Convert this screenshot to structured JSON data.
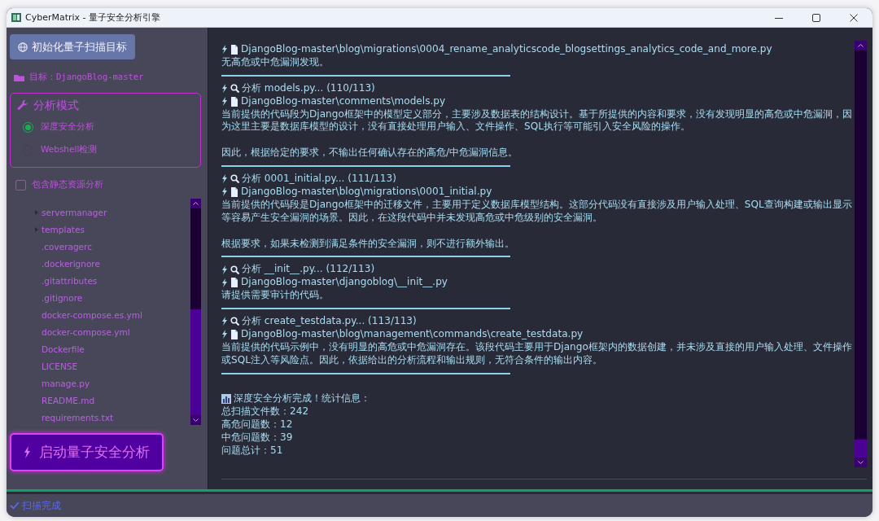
{
  "window": {
    "title": "CyberMatrix - 量子安全分析引擎"
  },
  "sidebar": {
    "init_button": "初始化量子扫描目标",
    "target": "目标：DjangoBlog-master",
    "mode_group": {
      "title": "分析模式",
      "options": [
        {
          "label": "深度安全分析",
          "selected": true
        },
        {
          "label": "Webshell检测",
          "selected": false
        }
      ]
    },
    "static_option": {
      "label": "包含静态资源分析",
      "checked": false
    },
    "file_tree": [
      {
        "name": "servermanager",
        "kind": "folder",
        "expanded": false
      },
      {
        "name": "templates",
        "kind": "folder",
        "expanded": false
      },
      {
        "name": ".coveragerc",
        "kind": "file"
      },
      {
        "name": ".dockerignore",
        "kind": "file"
      },
      {
        "name": ".gitattributes",
        "kind": "file"
      },
      {
        "name": ".gitignore",
        "kind": "file"
      },
      {
        "name": "docker-compose.es.yml",
        "kind": "file"
      },
      {
        "name": "docker-compose.yml",
        "kind": "file"
      },
      {
        "name": "Dockerfile",
        "kind": "file"
      },
      {
        "name": "LICENSE",
        "kind": "file"
      },
      {
        "name": "manage.py",
        "kind": "file"
      },
      {
        "name": "README.md",
        "kind": "file"
      },
      {
        "name": "requirements.txt",
        "kind": "file"
      }
    ],
    "start_button": "启动量子安全分析"
  },
  "log": {
    "lines": [
      {
        "kind": "file",
        "text": "DjangoBlog-master\\blog\\migrations\\0004_rename_analyticscode_blogsettings_analytics_code_and_more.py"
      },
      {
        "kind": "text",
        "text": "无高危或中危漏洞发现。"
      },
      {
        "kind": "divider"
      },
      {
        "kind": "analyze",
        "text": "分析 models.py... (110/113)"
      },
      {
        "kind": "file",
        "text": "DjangoBlog-master\\comments\\models.py"
      },
      {
        "kind": "text",
        "text": "当前提供的代码段为Django框架中的模型定义部分，主要涉及数据表的结构设计。基于所提供的内容和要求，没有发现明显的高危或中危漏洞，因为这里主要是数据库模型的设计，没有直接处理用户输入、文件操作、SQL执行等可能引入安全风险的操作。"
      },
      {
        "kind": "blank"
      },
      {
        "kind": "text",
        "text": "因此，根据给定的要求，不输出任何确认存在的高危/中危漏洞信息。"
      },
      {
        "kind": "divider"
      },
      {
        "kind": "analyze",
        "text": "分析 0001_initial.py... (111/113)"
      },
      {
        "kind": "file",
        "text": "DjangoBlog-master\\blog\\migrations\\0001_initial.py"
      },
      {
        "kind": "text",
        "text": "当前提供的代码段是Django框架中的迁移文件，主要用于定义数据库模型结构。这部分代码没有直接涉及用户输入处理、SQL查询构建或输出显示等容易产生安全漏洞的场景。因此，在这段代码中并未发现高危或中危级别的安全漏洞。"
      },
      {
        "kind": "blank"
      },
      {
        "kind": "text",
        "text": "根据要求，如果未检测到满足条件的安全漏洞，则不进行额外输出。"
      },
      {
        "kind": "divider"
      },
      {
        "kind": "analyze",
        "text": "分析 __init__.py... (112/113)"
      },
      {
        "kind": "file",
        "text": "DjangoBlog-master\\djangoblog\\__init__.py"
      },
      {
        "kind": "text",
        "text": "请提供需要审计的代码。"
      },
      {
        "kind": "divider"
      },
      {
        "kind": "analyze",
        "text": "分析 create_testdata.py... (113/113)"
      },
      {
        "kind": "file",
        "text": "DjangoBlog-master\\blog\\management\\commands\\create_testdata.py"
      },
      {
        "kind": "text",
        "text": "当前提供的代码示例中，没有明显的高危或中危漏洞存在。该段代码主要用于Django框架内的数据创建，并未涉及直接的用户输入处理、文件操作或SQL注入等风险点。因此，依据给出的分析流程和输出规则，无符合条件的输出内容。"
      },
      {
        "kind": "divider"
      },
      {
        "kind": "blank"
      },
      {
        "kind": "stats",
        "text": "深度安全分析完成！统计信息："
      },
      {
        "kind": "text",
        "text": "总扫描文件数：242"
      },
      {
        "kind": "text",
        "text": "高危问题数：12"
      },
      {
        "kind": "text",
        "text": "中危问题数：39"
      },
      {
        "kind": "text",
        "text": "问题总计：51"
      }
    ]
  },
  "status_bar": {
    "text": "扫描完成"
  }
}
